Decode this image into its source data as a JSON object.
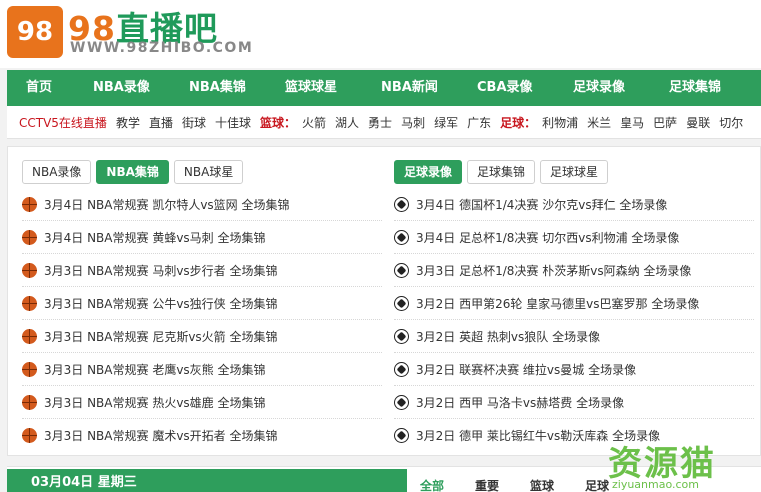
{
  "header": {
    "logo_mark": "98",
    "title_num": "98",
    "title_text": "直播吧",
    "url": "WWW.98ZHIBO.COM"
  },
  "nav": [
    {
      "label": "首页"
    },
    {
      "label": "NBA录像"
    },
    {
      "label": "NBA集锦"
    },
    {
      "label": "篮球球星"
    },
    {
      "label": "NBA新闻"
    },
    {
      "label": "CBA录像"
    },
    {
      "label": "足球录像"
    },
    {
      "label": "足球集锦"
    }
  ],
  "quick": {
    "cctv": "CCTV5在线直播",
    "general": [
      "教学",
      "直播",
      "街球",
      "十佳球"
    ],
    "basketball_label": "篮球：",
    "basketball": [
      "火箭",
      "湖人",
      "勇士",
      "马刺",
      "绿军",
      "广东"
    ],
    "football_label": "足球：",
    "football": [
      "利物浦",
      "米兰",
      "皇马",
      "巴萨",
      "曼联",
      "切尔"
    ]
  },
  "left": {
    "tabs": [
      "NBA录像",
      "NBA集锦",
      "NBA球星"
    ],
    "active_tab": 1,
    "items": [
      "3月4日 NBA常规赛 凯尔特人vs篮网 全场集锦",
      "3月4日 NBA常规赛 黄蜂vs马刺 全场集锦",
      "3月3日 NBA常规赛 马刺vs步行者 全场集锦",
      "3月3日 NBA常规赛 公牛vs独行侠 全场集锦",
      "3月3日 NBA常规赛 尼克斯vs火箭 全场集锦",
      "3月3日 NBA常规赛 老鹰vs灰熊 全场集锦",
      "3月3日 NBA常规赛 热火vs雄鹿 全场集锦",
      "3月3日 NBA常规赛 魔术vs开拓者 全场集锦"
    ]
  },
  "right": {
    "tabs": [
      "足球录像",
      "足球集锦",
      "足球球星"
    ],
    "active_tab": 0,
    "items": [
      "3月4日 德国杯1/4决赛 沙尔克vs拜仁 全场录像",
      "3月4日 足总杯1/8决赛 切尔西vs利物浦 全场录像",
      "3月3日 足总杯1/8决赛 朴茨茅斯vs阿森纳 全场录像",
      "3月2日 西甲第26轮 皇家马德里vs巴塞罗那 全场录像",
      "3月2日 英超 热刺vs狼队 全场录像",
      "3月2日 联赛杯决赛 维拉vs曼城 全场录像",
      "3月2日 西甲 马洛卡vs赫塔费 全场录像",
      "3月2日 德甲 莱比锡红牛vs勒沃库森 全场录像"
    ]
  },
  "bottom": {
    "date": "03月04日 星期三",
    "tabs": [
      "全部",
      "重要",
      "篮球",
      "足球"
    ]
  },
  "watermark": {
    "text": "资源猫",
    "url": "ziyuanmao.com"
  },
  "colors": {
    "brand_green": "#2e9e5c",
    "brand_orange": "#e8731c",
    "highlight_red": "#c8161e"
  }
}
